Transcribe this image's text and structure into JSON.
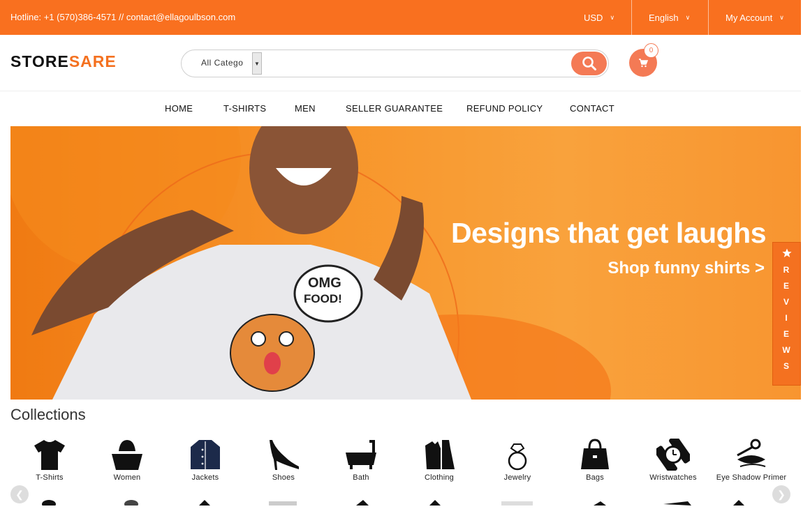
{
  "topbar": {
    "hotline": "Hotline: +1 (570)386-4571 // contact@ellagoulbson.com",
    "currency": "USD",
    "language": "English",
    "account": "My Account"
  },
  "header": {
    "logo_part1": "STORE",
    "logo_part2": "SARE",
    "search_category": "All Catego",
    "search_placeholder": "",
    "cart_count": "0"
  },
  "nav": [
    "HOME",
    "T-SHIRTS",
    "MEN",
    "SELLER GUARANTEE",
    "REFUND POLICY",
    "CONTACT"
  ],
  "banner": {
    "headline": "Designs that get laughs",
    "cta": "Shop funny shirts >",
    "shirt_text_1": "OMG",
    "shirt_text_2": "FOOD!"
  },
  "reviews_tab": [
    "R",
    "E",
    "V",
    "I",
    "E",
    "W",
    "S"
  ],
  "collections": {
    "title": "Collections",
    "items": [
      {
        "label": "T-Shirts",
        "icon": "tshirt-icon"
      },
      {
        "label": "Women",
        "icon": "women-hat-icon"
      },
      {
        "label": "Jackets",
        "icon": "jacket-icon"
      },
      {
        "label": "Shoes",
        "icon": "heel-shoe-icon"
      },
      {
        "label": "Bath",
        "icon": "bathtub-icon"
      },
      {
        "label": "Clothing",
        "icon": "clothing-icon"
      },
      {
        "label": "Jewelry",
        "icon": "ring-icon"
      },
      {
        "label": "Bags",
        "icon": "handbag-icon"
      },
      {
        "label": "Wristwatches",
        "icon": "wristwatch-icon"
      },
      {
        "label": "Eye Shadow Primer",
        "icon": "eye-shadow-icon"
      }
    ]
  },
  "colors": {
    "accent": "#f9701f",
    "button": "#f47a55",
    "banner": "#f7952a"
  }
}
